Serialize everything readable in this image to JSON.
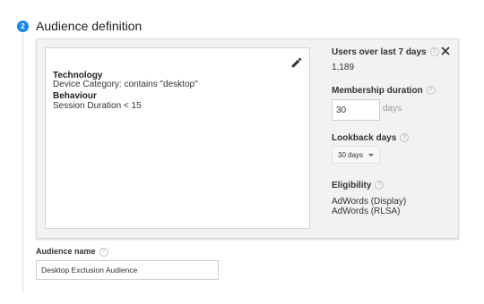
{
  "step": {
    "number": "2",
    "title": "Audience definition"
  },
  "conditions": [
    {
      "heading": "Technology",
      "value": "Device Category: contains \"desktop\""
    },
    {
      "heading": "Behaviour",
      "value": "Session Duration < 15"
    }
  ],
  "users": {
    "label": "Users over last 7 days",
    "value": "1,189"
  },
  "membership": {
    "label": "Membership duration",
    "value": "30",
    "unit": "days"
  },
  "lookback": {
    "label": "Lookback days",
    "selected": "30 days"
  },
  "eligibility": {
    "label": "Eligibility",
    "items": [
      "AdWords (Display)",
      "AdWords (RLSA)"
    ]
  },
  "audience_name": {
    "label": "Audience name",
    "value": "Desktop Exclusion Audience"
  },
  "help_glyph": "?",
  "colors": {
    "step_accent": "#1e88e5",
    "panel_bg": "#f2f2f2"
  },
  "icons": {
    "edit": "pencil-icon",
    "close": "close-icon",
    "help": "help-icon",
    "dropdown": "caret-down-icon"
  }
}
